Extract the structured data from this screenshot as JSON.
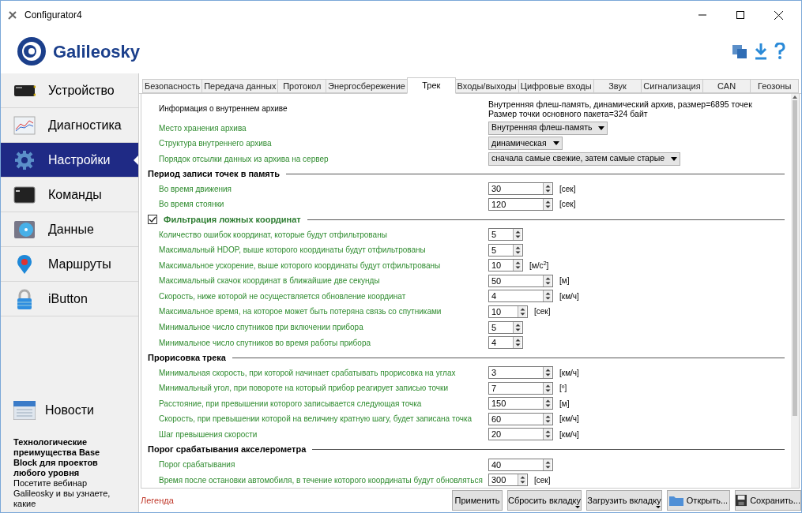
{
  "window": {
    "title": "Configurator4"
  },
  "header": {
    "logo_text": "Galileosky"
  },
  "sidebar": {
    "items": [
      {
        "label": "Устройство",
        "selected": false
      },
      {
        "label": "Диагностика",
        "selected": false
      },
      {
        "label": "Настройки",
        "selected": true
      },
      {
        "label": "Команды",
        "selected": false
      },
      {
        "label": "Данные",
        "selected": false
      },
      {
        "label": "Маршруты",
        "selected": false
      },
      {
        "label": "iButton",
        "selected": false
      }
    ],
    "news": {
      "label": "Новости",
      "headline": "Технологические преимущества Base Block для проектов любого уровня",
      "text": "Посетите вебинар Galileosky и вы узнаете, какие"
    }
  },
  "tabs": [
    {
      "label": "Безопасность",
      "selected": false
    },
    {
      "label": "Передача данных",
      "selected": false
    },
    {
      "label": "Протокол",
      "selected": false
    },
    {
      "label": "Энергосбережение",
      "selected": false
    },
    {
      "label": "Трек",
      "selected": true
    },
    {
      "label": "Входы/выходы",
      "selected": false
    },
    {
      "label": "Цифровые входы",
      "selected": false
    },
    {
      "label": "Звук",
      "selected": false
    },
    {
      "label": "Сигнализация",
      "selected": false
    },
    {
      "label": "CAN",
      "selected": false
    },
    {
      "label": "Геозоны",
      "selected": false
    }
  ],
  "sections": [
    {
      "rows": [
        {
          "kind": "info",
          "label": "Информация о внутреннем архиве",
          "lines": [
            "Внутренняя флеш-память, динамический архив, размер=6895 точек",
            "Размер точки основного пакета=324 байт"
          ]
        },
        {
          "kind": "dropdown",
          "label": "Место хранения архива",
          "value": "Внутренняя флеш-память"
        },
        {
          "kind": "dropdown",
          "label": "Структура внутреннего архива",
          "value": "динамическая"
        },
        {
          "kind": "dropdown",
          "label": "Порядок отсылки данных из архива на сервер",
          "value": "сначала самые свежие, затем самые старые"
        }
      ]
    },
    {
      "title": "Период записи точек в память",
      "rows": [
        {
          "kind": "spin",
          "label": "Во время движения",
          "value": "30",
          "unit": "[сек]"
        },
        {
          "kind": "spin",
          "label": "Во время стоянки",
          "value": "120",
          "unit": "[сек]"
        }
      ]
    },
    {
      "title": "Фильтрация ложных координат",
      "checked": true,
      "rows": [
        {
          "kind": "spin_short",
          "label": "Количество ошибок координат, которые будут отфильтрованы",
          "value": "5"
        },
        {
          "kind": "spin_short",
          "label": "Максимальный HDOP, выше которого координаты будут отфильтрованы",
          "value": "5"
        },
        {
          "kind": "spin_short",
          "label": "Максимальное ускорение, выше которого координаты будут отфильтрованы",
          "value": "10",
          "unit": "[м/с$^{2}$]"
        },
        {
          "kind": "spin",
          "label": "Максимальный скачок координат в ближайшие две секунды",
          "value": "50",
          "unit": "[м]"
        },
        {
          "kind": "spin",
          "label": "Скорость, ниже которой не осуществляется обновление координат",
          "value": "4",
          "unit": "[км/ч]"
        },
        {
          "kind": "spin_mid",
          "label": "Максимальное время, на которое может быть потеряна связь со спутниками",
          "value": "10",
          "unit": "[сек]"
        },
        {
          "kind": "spin_short",
          "label": "Минимальное число спутников при включении прибора",
          "value": "5"
        },
        {
          "kind": "spin_short",
          "label": "Минимальное число спутников во время работы прибора",
          "value": "4"
        }
      ]
    },
    {
      "title": "Прорисовка трека",
      "rows": [
        {
          "kind": "spin",
          "label": "Минимальная скорость, при которой начинает срабатывать прорисовка на углах",
          "value": "3",
          "unit": "[км/ч]"
        },
        {
          "kind": "spin",
          "label": "Минимальный угол, при повороте на который прибор реагирует записью точки",
          "value": "7",
          "unit": "[º]"
        },
        {
          "kind": "spin",
          "label": "Расстояние, при превышении которого записывается следующая точка",
          "value": "150",
          "unit": "[м]"
        },
        {
          "kind": "spin",
          "label": "Скорость, при превышении которой на величину кратную шагу, будет записана точка",
          "value": "60",
          "unit": "[км/ч]"
        },
        {
          "kind": "spin",
          "label": "Шаг превышения скорости",
          "value": "20",
          "unit": "[км/ч]"
        }
      ]
    },
    {
      "title": "Порог срабатывания акселерометра",
      "rows": [
        {
          "kind": "spin",
          "label": "Порог срабатывания",
          "value": "40"
        },
        {
          "kind": "spin_mid",
          "label": "Время после остановки автомобиля, в течение которого координаты будут обновляться",
          "value": "300",
          "unit": "[сек]"
        }
      ]
    }
  ],
  "footer": {
    "legend": "Легенда",
    "buttons": [
      {
        "label": "Применить",
        "kind": "plain"
      },
      {
        "label": "Сбросить вкладку",
        "kind": "menu"
      },
      {
        "label": "Загрузить вкладку",
        "kind": "menu"
      },
      {
        "label": "Открыть...",
        "kind": "open"
      },
      {
        "label": "Сохранить...",
        "kind": "save"
      }
    ]
  }
}
